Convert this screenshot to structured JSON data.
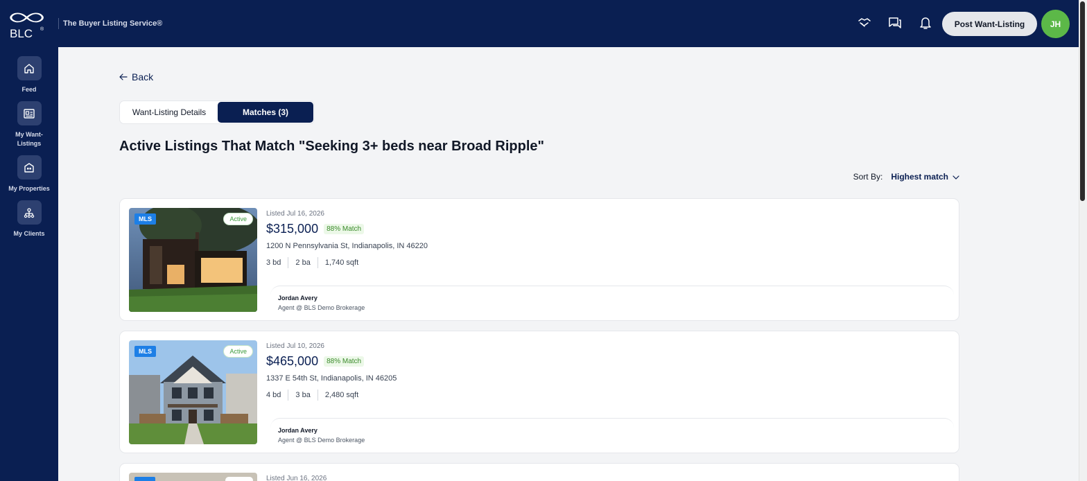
{
  "brand": {
    "logo_text": "BLC",
    "tagline": "The Buyer Listing Service®"
  },
  "header": {
    "icons": [
      "handshake-icon",
      "chat-icon",
      "bell-icon"
    ],
    "post_button": "Post Want-Listing",
    "avatar_initials": "JH"
  },
  "sidebar": {
    "items": [
      {
        "label": "Feed",
        "icon": "home-icon"
      },
      {
        "label": "My Want-Listings",
        "icon": "listing-icon"
      },
      {
        "label": "My Properties",
        "icon": "property-icon"
      },
      {
        "label": "My Clients",
        "icon": "clients-icon"
      }
    ]
  },
  "main": {
    "back_label": "Back",
    "tabs": [
      {
        "label": "Want-Listing Details",
        "active": false
      },
      {
        "label": "Matches (3)",
        "active": true
      }
    ],
    "title": "Active Listings That Match \"Seeking 3+ beds near Broad Ripple\"",
    "sort": {
      "label": "Sort By:",
      "value": "Highest match"
    },
    "listings": [
      {
        "badge": "MLS",
        "status": "Active",
        "listed": "Listed Jul 16, 2026",
        "price": "$315,000",
        "match": "88% Match",
        "address": "1200 N Pennsylvania St, Indianapolis, IN 46220",
        "beds": "3 bd",
        "baths": "2 ba",
        "sqft": "1,740 sqft",
        "agent_name": "Jordan Avery",
        "agent_role": "Agent @ BLS Demo Brokerage"
      },
      {
        "badge": "MLS",
        "status": "Active",
        "listed": "Listed Jul 10, 2026",
        "price": "$465,000",
        "match": "88% Match",
        "address": "1337 E 54th St, Indianapolis, IN 46205",
        "beds": "4 bd",
        "baths": "3 ba",
        "sqft": "2,480 sqft",
        "agent_name": "Jordan Avery",
        "agent_role": "Agent @ BLS Demo Brokerage"
      },
      {
        "listed": "Listed Jun 16, 2026"
      }
    ]
  },
  "colors": {
    "navy": "#0a1f52",
    "accent_green": "#5cb848",
    "mls_blue": "#1d7fe6"
  }
}
